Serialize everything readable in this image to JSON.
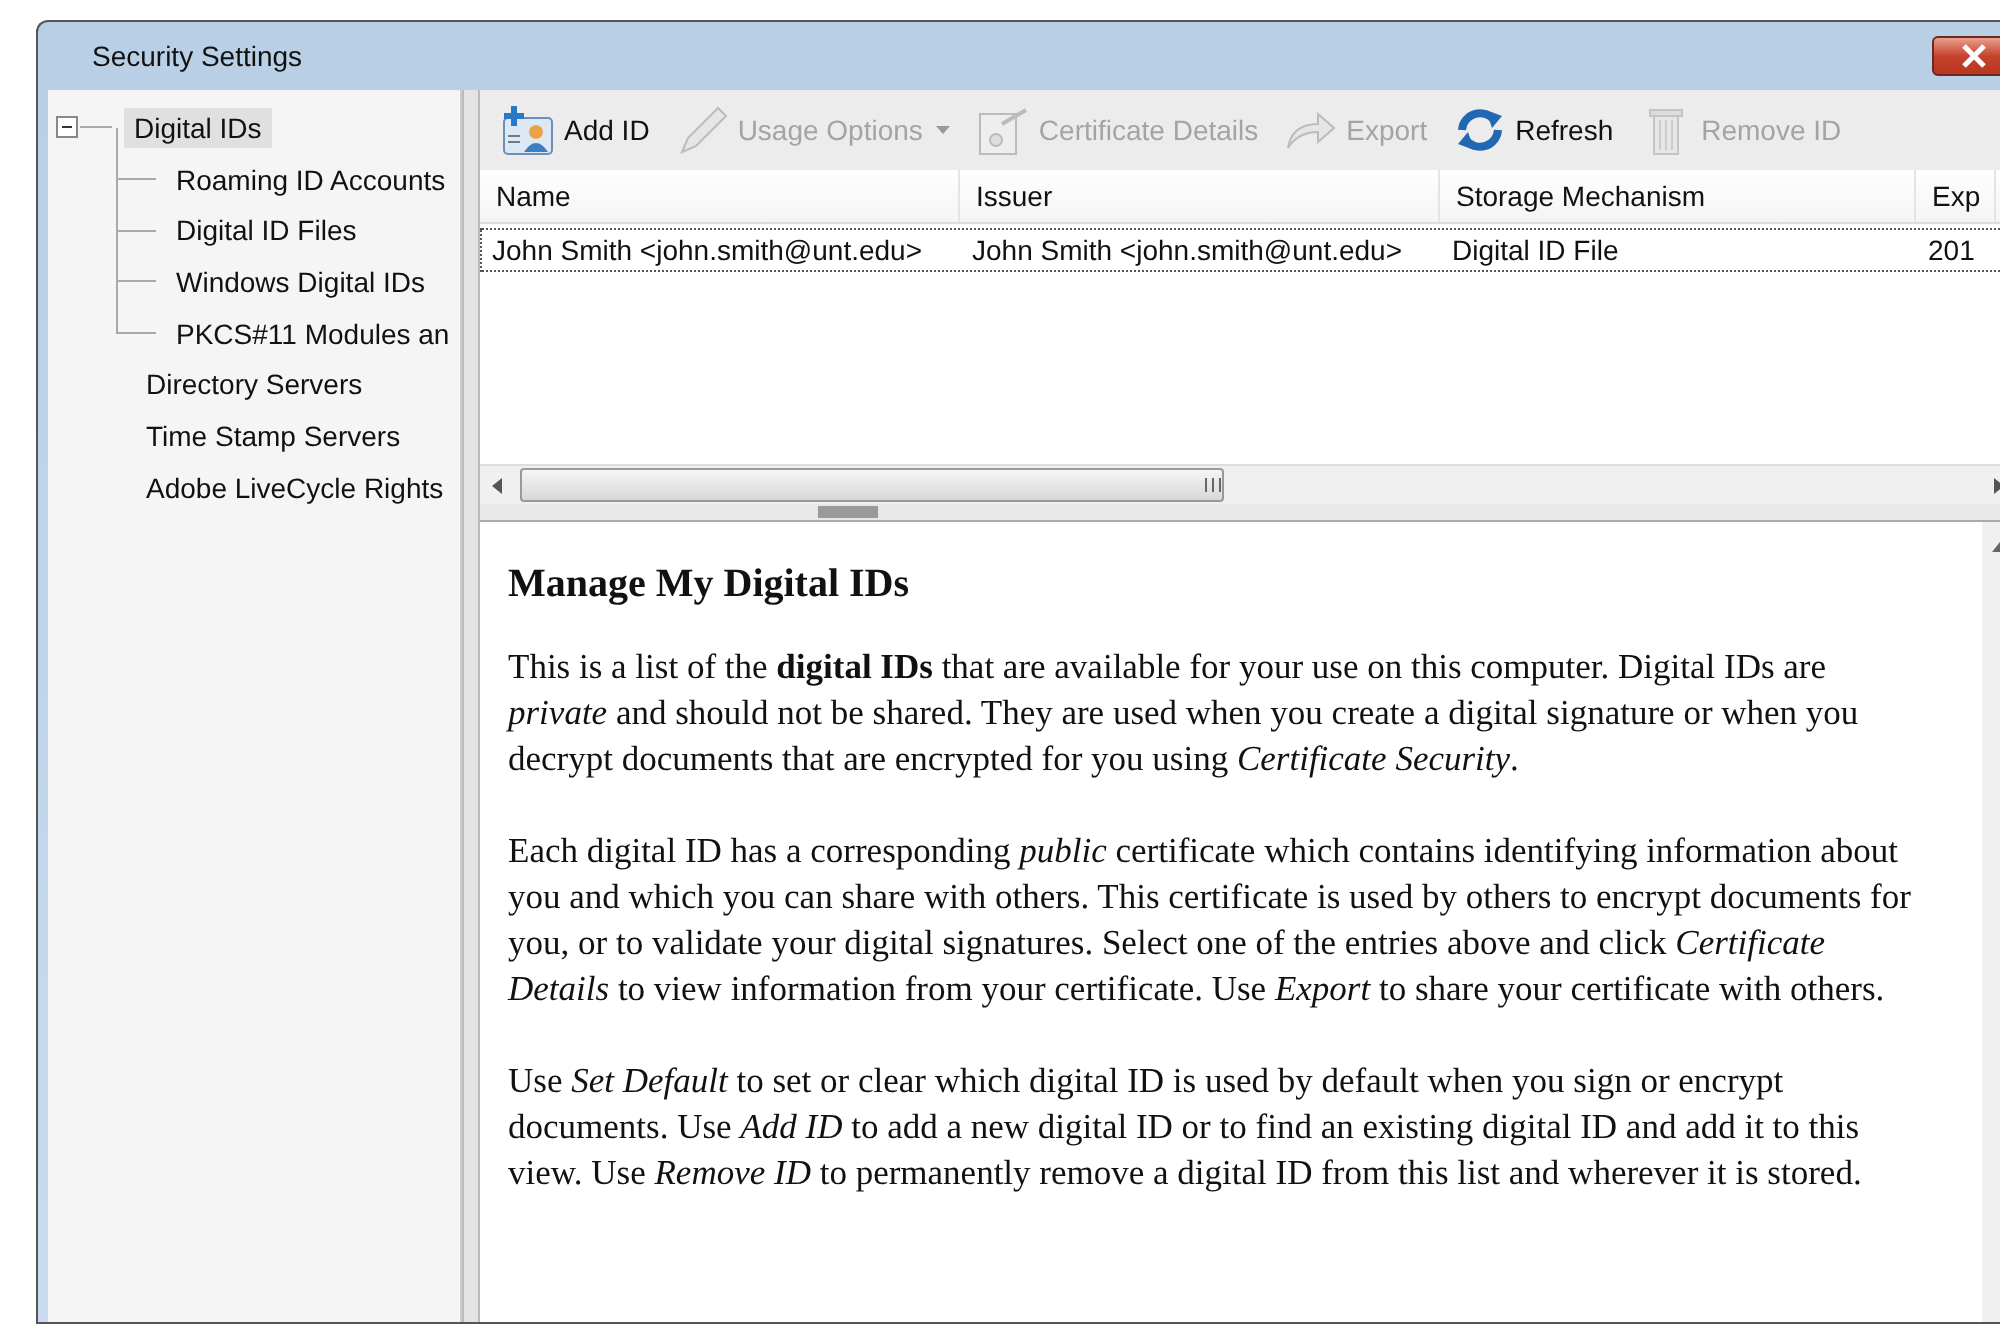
{
  "window": {
    "title": "Security Settings"
  },
  "tree": [
    {
      "label": "Digital IDs",
      "selected": true,
      "expanded": true,
      "children": [
        {
          "label": "Roaming ID Accounts",
          "selected": false
        },
        {
          "label": "Digital ID Files",
          "selected": false
        },
        {
          "label": "Windows Digital IDs",
          "selected": false
        },
        {
          "label": "PKCS#11 Modules an",
          "selected": false
        }
      ]
    },
    {
      "label": "Directory Servers",
      "selected": false
    },
    {
      "label": "Time Stamp Servers",
      "selected": false
    },
    {
      "label": "Adobe LiveCycle Rights",
      "selected": false
    }
  ],
  "toolbar": [
    {
      "label": "Add ID",
      "kind": "add",
      "disabled": false,
      "has_menu": false
    },
    {
      "label": "Usage Options",
      "kind": "options",
      "disabled": true,
      "has_menu": true
    },
    {
      "label": "Certificate Details",
      "kind": "details",
      "disabled": true,
      "has_menu": false
    },
    {
      "label": "Export",
      "kind": "export",
      "disabled": true,
      "has_menu": false
    },
    {
      "label": "Refresh",
      "kind": "refresh",
      "disabled": false,
      "has_menu": false
    },
    {
      "label": "Remove ID",
      "kind": "remove",
      "disabled": true,
      "has_menu": false
    }
  ],
  "table": {
    "columns": [
      "Name",
      "Issuer",
      "Storage Mechanism",
      "Exp"
    ],
    "rows": [
      {
        "cells": [
          "John Smith <john.smith@unt.edu>",
          "John Smith <john.smith@unt.edu>",
          "Digital ID File",
          "201"
        ],
        "selected": true
      }
    ]
  },
  "help": {
    "title": "Manage My Digital IDs",
    "paragraphs": [
      "This is a list of the **digital IDs** that are available for your use on this computer. Digital IDs are *private* and should not be shared. They are used when you create a digital signature or when you decrypt documents that are encrypted for you using *Certificate Security*.",
      "Each digital ID has a corresponding *public* certificate which contains identifying information about you and which you can share with others. This certificate is used by others to encrypt documents for you, or to validate your digital signatures. Select one of the entries above and click *Certificate Details* to view information from your certificate. Use *Export* to share your certificate with others.",
      "Use *Set Default* to set or clear which digital ID is used by default when you sign or encrypt documents. Use *Add ID* to add a new digital ID or to find an existing digital ID and add it to this view. Use *Remove ID* to permanently remove a digital ID from this list and wherever it is stored."
    ]
  }
}
